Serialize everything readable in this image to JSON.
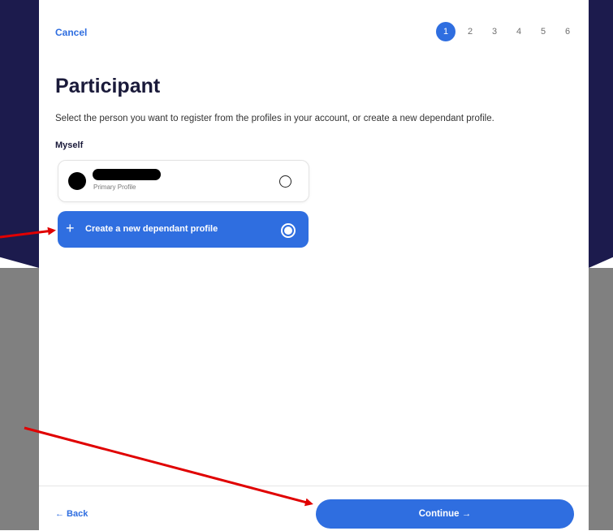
{
  "header": {
    "cancel_label": "Cancel",
    "steps": [
      "1",
      "2",
      "3",
      "4",
      "5",
      "6"
    ],
    "active_step": "1"
  },
  "main": {
    "title": "Participant",
    "subtitle": "Select the person you want to register from the profiles in your account, or create a new dependant profile.",
    "section_label": "Myself",
    "profile_card": {
      "sub_label": "Primary Profile"
    },
    "new_profile": {
      "icon": "plus-icon",
      "label": "Create a new dependant profile",
      "selected": true
    }
  },
  "footer": {
    "back_label": "← Back",
    "continue_label": "Continue →"
  },
  "colors": {
    "accent": "#2f6ee0",
    "navy": "#1c1b4d",
    "annotation_arrow": "#e00000"
  }
}
